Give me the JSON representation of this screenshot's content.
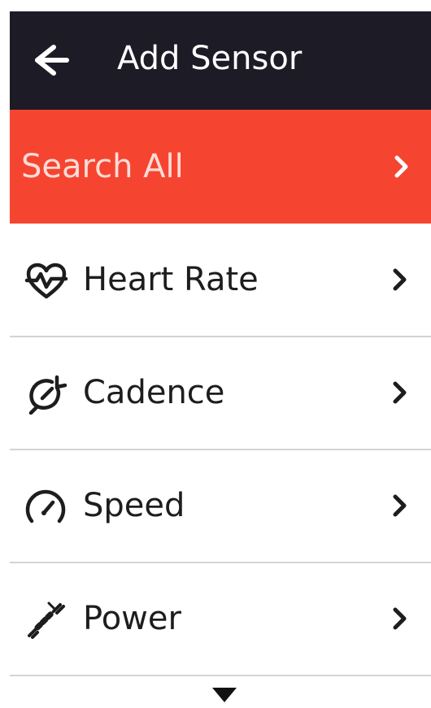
{
  "header": {
    "title": "Add Sensor",
    "back_icon": "arrow-left-icon"
  },
  "search_all": {
    "label": "Search All",
    "chevron_icon": "chevron-right-icon"
  },
  "sensors": [
    {
      "label": "Heart Rate",
      "icon": "heart-rate-icon"
    },
    {
      "label": "Cadence",
      "icon": "cadence-icon"
    },
    {
      "label": "Speed",
      "icon": "speedometer-icon"
    },
    {
      "label": "Power",
      "icon": "power-meter-icon"
    }
  ],
  "more_indicator": {
    "icon": "triangle-down-icon"
  },
  "colors": {
    "header_bg": "#1c1b26",
    "accent": "#f54531",
    "text": "#1d1d1d",
    "divider": "#d4d4d4"
  }
}
